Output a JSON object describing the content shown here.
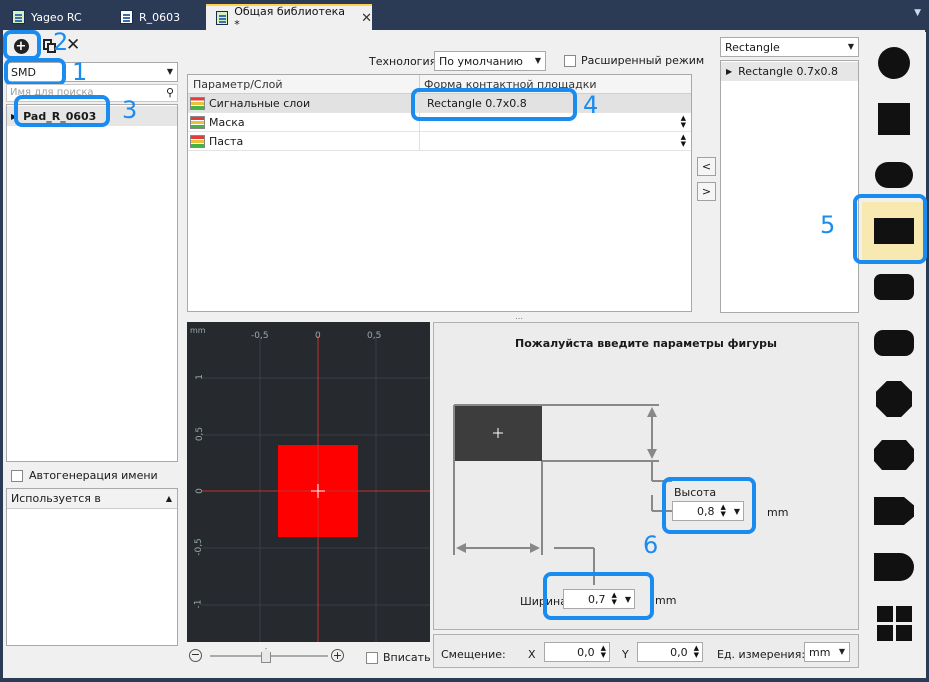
{
  "tabs": [
    {
      "label": "Yageo RC"
    },
    {
      "label": "R_0603"
    },
    {
      "label": "Общая библиотека *"
    }
  ],
  "left": {
    "mount_type": "SMD",
    "search_placeholder": "Имя для поиска",
    "tree_item": "Pad_R_0603",
    "autogen_label": "Автогенерация имени",
    "used_in_label": "Используется в"
  },
  "top": {
    "technology_label": "Технология",
    "technology_value": "По умолчанию",
    "extended_mode_label": "Расширенный режим"
  },
  "grid": {
    "col1": "Параметр/Слой",
    "col2": "Форма контактной площадки",
    "rows": [
      {
        "layer": "Сигнальные слои",
        "shape": "Rectangle 0.7x0.8"
      },
      {
        "layer": "Маска",
        "shape": ""
      },
      {
        "layer": "Паста",
        "shape": ""
      }
    ]
  },
  "move_left": "<",
  "move_right": ">",
  "right_list": {
    "filter_value": "Rectangle",
    "item": "Rectangle 0.7x0.8"
  },
  "canvas": {
    "unit": "mm",
    "x_ticks": [
      "-0,5",
      "0",
      "0,5"
    ],
    "y_ticks": [
      "1",
      "0,5",
      "0",
      "-0,5",
      "-1"
    ],
    "fit_label": "Вписать"
  },
  "params": {
    "title": "Пожалуйста введите параметры фигуры",
    "height_label": "Высота",
    "height_value": "0,8",
    "height_unit": "mm",
    "width_label": "Ширина",
    "width_value": "0,7",
    "width_unit": "mm"
  },
  "offset": {
    "label": "Смещение:",
    "x_label": "X",
    "x_value": "0,0",
    "y_label": "Y",
    "y_value": "0,0",
    "units_label": "Ед. измерения:",
    "units_value": "mm"
  },
  "annotations": [
    "1",
    "2",
    "3",
    "4",
    "5",
    "6"
  ],
  "colors": {
    "highlight": "#1a8cf0",
    "pad": "#ff0000",
    "canvas": "#26292e",
    "selected_shape_bg": "#f7e9b0"
  }
}
